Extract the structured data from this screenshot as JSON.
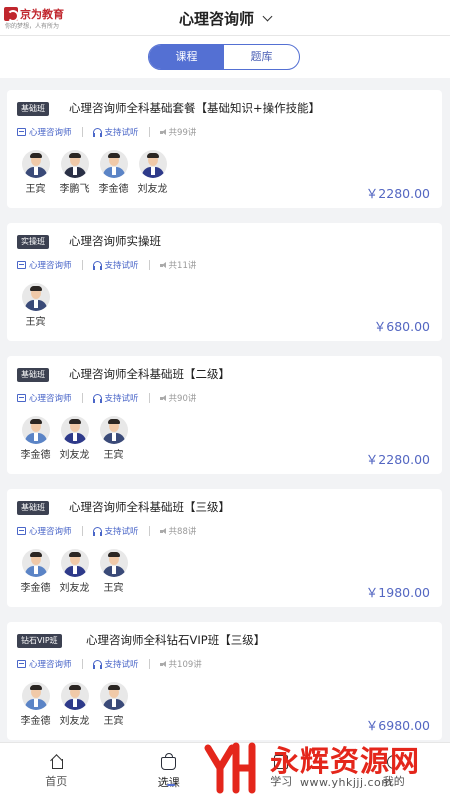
{
  "header": {
    "brand_name": "京为教育",
    "brand_slogan": "你的梦想，人有所为",
    "title": "心理咨询师"
  },
  "tabs": [
    {
      "label": "课程",
      "active": true
    },
    {
      "label": "题库",
      "active": false
    }
  ],
  "labels": {
    "category": "心理咨询师",
    "trial": "支持试听"
  },
  "courses": [
    {
      "badge": "基础班",
      "title": "心理咨询师全科基础套餐【基础知识+操作技能】",
      "lessons": "共99讲",
      "teachers": [
        {
          "name": "王宾",
          "suit": "#3a4a78"
        },
        {
          "name": "李鹏飞",
          "suit": "#2a3046"
        },
        {
          "name": "李金德",
          "suit": "#5b84c6"
        },
        {
          "name": "刘友龙",
          "suit": "#2e3a8a"
        }
      ],
      "price": "￥2280.00"
    },
    {
      "badge": "实操班",
      "title": "心理咨询师实操班",
      "lessons": "共11讲",
      "teachers": [
        {
          "name": "王宾",
          "suit": "#3a4a78"
        }
      ],
      "price": "￥680.00"
    },
    {
      "badge": "基础班",
      "title": "心理咨询师全科基础班【二级】",
      "lessons": "共90讲",
      "teachers": [
        {
          "name": "李金德",
          "suit": "#5b84c6"
        },
        {
          "name": "刘友龙",
          "suit": "#2e3a8a"
        },
        {
          "name": "王宾",
          "suit": "#3a4a78"
        }
      ],
      "price": "￥2280.00"
    },
    {
      "badge": "基础班",
      "title": "心理咨询师全科基础班【三级】",
      "lessons": "共88讲",
      "teachers": [
        {
          "name": "李金德",
          "suit": "#5b84c6"
        },
        {
          "name": "刘友龙",
          "suit": "#2e3a8a"
        },
        {
          "name": "王宾",
          "suit": "#3a4a78"
        }
      ],
      "price": "￥1980.00"
    },
    {
      "badge": "钻石VIP班",
      "title": "心理咨询师全科钻石VIP班【三级】",
      "lessons": "共109讲",
      "teachers": [
        {
          "name": "李金德",
          "suit": "#5b84c6"
        },
        {
          "name": "刘友龙",
          "suit": "#2e3a8a"
        },
        {
          "name": "王宾",
          "suit": "#3a4a78"
        }
      ],
      "price": "￥6980.00"
    }
  ],
  "bottom_nav": [
    {
      "label": "首页",
      "icon": "home-icon"
    },
    {
      "label": "选课",
      "icon": "shopping-bag-icon",
      "active": true
    },
    {
      "label": "学习",
      "icon": "study-icon"
    },
    {
      "label": "我的",
      "icon": "user-icon"
    }
  ],
  "watermark": {
    "name": "永辉资源网",
    "url": "www.yhkjjj.com"
  },
  "colors": {
    "accent": "#5470d3",
    "badge_bg": "#3c4151",
    "watermark": "#e4261b"
  }
}
